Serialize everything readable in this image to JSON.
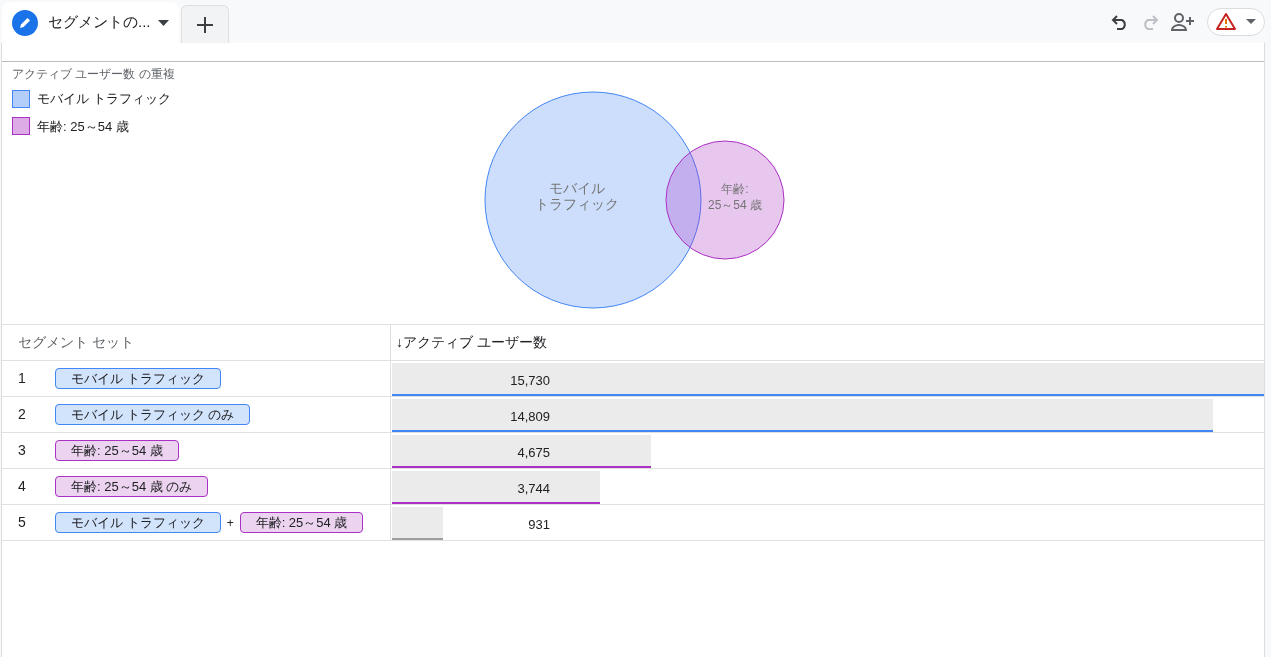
{
  "tabs": [
    {
      "label": "セグメントの...",
      "selected": true
    }
  ],
  "toolbar": {
    "undo_disabled": false,
    "redo_disabled": true
  },
  "chart": {
    "title": "アクティブ ユーザー数 の重複",
    "legend": [
      {
        "label": "モバイル トラフィック",
        "color": "#4285f4"
      },
      {
        "label": "年齢: 25～54 歳",
        "color": "#ab30c4"
      }
    ],
    "circles": [
      {
        "label_lines": [
          "モバイル",
          "トラフィック"
        ],
        "color": "#4285f4"
      },
      {
        "label_lines": [
          "年齢:",
          "25～54 歳"
        ],
        "color": "#ab30c4"
      }
    ]
  },
  "table": {
    "columns": [
      "セグメント セット",
      "↓アクティブ ユーザー数"
    ],
    "rows": [
      {
        "index": "1",
        "segments": [
          {
            "label": "モバイル トラフィック",
            "kind": "mobile"
          }
        ],
        "value": "15,730",
        "level": 1.0,
        "color": "#4285f4"
      },
      {
        "index": "2",
        "segments": [
          {
            "label": "モバイル トラフィック のみ",
            "kind": "mobile"
          }
        ],
        "value": "14,809",
        "level": 0.942,
        "color": "#4285f4"
      },
      {
        "index": "3",
        "segments": [
          {
            "label": "年齢: 25～54 歳",
            "kind": "age"
          }
        ],
        "value": "4,675",
        "level": 0.297,
        "color": "#ab30c4"
      },
      {
        "index": "4",
        "segments": [
          {
            "label": "年齢: 25～54 歳 のみ",
            "kind": "age"
          }
        ],
        "value": "3,744",
        "level": 0.238,
        "color": "#ab30c4"
      },
      {
        "index": "5",
        "segments": [
          {
            "label": "モバイル トラフィック",
            "kind": "mobile"
          },
          {
            "label": "年齢: 25～54 歳",
            "kind": "age"
          }
        ],
        "joiner": "+",
        "value": "931",
        "level": 0.058,
        "color": "#9e9e9e"
      }
    ]
  }
}
